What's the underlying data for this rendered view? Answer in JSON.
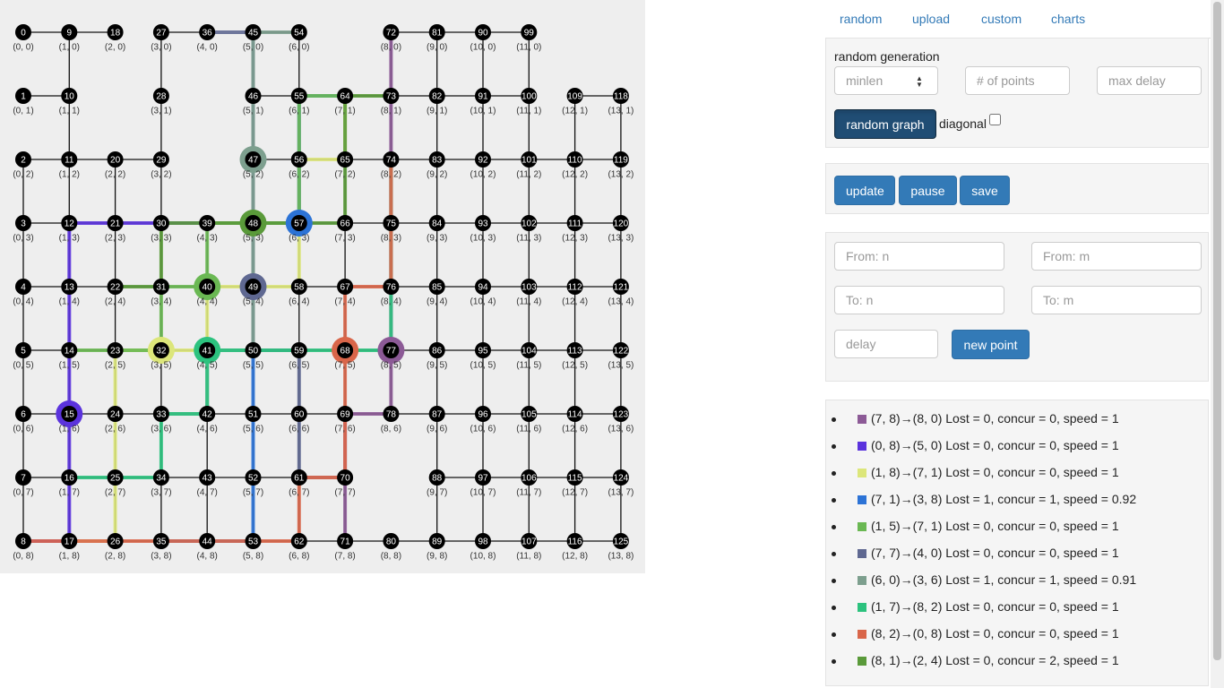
{
  "nav": {
    "random": "random",
    "upload": "upload",
    "custom": "custom",
    "charts": "charts"
  },
  "random_generation": {
    "title": "random generation",
    "minlen_placeholder": "minlen",
    "points_placeholder": "# of points",
    "max_delay_placeholder": "max delay",
    "random_graph_label": "random graph",
    "diagonal_label": "diagonal",
    "diagonal_checked": false
  },
  "controls": {
    "update_label": "update",
    "pause_label": "pause",
    "save_label": "save"
  },
  "new_point": {
    "from_n_placeholder": "From: n",
    "from_m_placeholder": "From: m",
    "to_n_placeholder": "To: n",
    "to_m_placeholder": "To: m",
    "delay_placeholder": "delay",
    "new_point_label": "new point"
  },
  "legend": [
    {
      "color": "#8c5a96",
      "text": "(7, 8)→(8, 0) Lost = 0, concur = 0, speed = 1"
    },
    {
      "color": "#5b33dd",
      "text": "(0, 8)→(5, 0) Lost = 0, concur = 0, speed = 1"
    },
    {
      "color": "#dce67a",
      "text": "(1, 8)→(7, 1) Lost = 0, concur = 0, speed = 1"
    },
    {
      "color": "#2c73d6",
      "text": "(7, 1)→(3, 8) Lost = 1, concur = 1, speed = 0.92"
    },
    {
      "color": "#6ab853",
      "text": "(1, 5)→(7, 1) Lost = 0, concur = 0, speed = 1"
    },
    {
      "color": "#5f6891",
      "text": "(7, 7)→(4, 0) Lost = 0, concur = 0, speed = 1"
    },
    {
      "color": "#7d9f8e",
      "text": "(6, 0)→(3, 6) Lost = 1, concur = 1, speed = 0.91"
    },
    {
      "color": "#2cc27e",
      "text": "(1, 7)→(8, 2) Lost = 0, concur = 0, speed = 1"
    },
    {
      "color": "#d9664a",
      "text": "(8, 2)→(0, 8) Lost = 0, concur = 0, speed = 1"
    },
    {
      "color": "#5a9a3a",
      "text": "(8, 1)→(2, 4) Lost = 0, concur = 2, speed = 1"
    }
  ],
  "graph": {
    "node_ids": [
      [
        0,
        1,
        2,
        3,
        4,
        5,
        6,
        7,
        8
      ],
      [
        9,
        10,
        11,
        12,
        13,
        14,
        15,
        16,
        17
      ],
      [
        18,
        null,
        20,
        21,
        22,
        23,
        24,
        25,
        26
      ],
      [
        27,
        28,
        29,
        30,
        31,
        32,
        33,
        34,
        35
      ],
      [
        36,
        null,
        null,
        39,
        40,
        41,
        42,
        43,
        44
      ],
      [
        45,
        46,
        47,
        48,
        49,
        50,
        51,
        52,
        53
      ],
      [
        54,
        55,
        56,
        57,
        58,
        59,
        60,
        61,
        62
      ],
      [
        null,
        64,
        65,
        66,
        67,
        68,
        69,
        70,
        71
      ],
      [
        72,
        73,
        74,
        75,
        76,
        77,
        78,
        null,
        80
      ],
      [
        81,
        82,
        83,
        84,
        85,
        86,
        87,
        88,
        89
      ],
      [
        90,
        91,
        92,
        93,
        94,
        95,
        96,
        97,
        98
      ],
      [
        99,
        100,
        101,
        102,
        103,
        104,
        105,
        106,
        107
      ],
      [
        null,
        109,
        110,
        111,
        112,
        113,
        114,
        115,
        116
      ],
      [
        null,
        118,
        119,
        120,
        121,
        122,
        123,
        124,
        125
      ]
    ],
    "missing_edges": [
      [
        [
          2,
          0
        ],
        [
          3,
          0
        ]
      ],
      [
        [
          4,
          0
        ],
        [
          5,
          0
        ]
      ],
      [
        [
          6,
          0
        ],
        [
          8,
          0
        ]
      ],
      [
        [
          0,
          0
        ],
        [
          0,
          1
        ]
      ],
      [
        [
          0,
          1
        ],
        [
          0,
          2
        ]
      ],
      [
        [
          2,
          0
        ],
        [
          2,
          1
        ]
      ],
      [
        [
          2,
          1
        ],
        [
          2,
          2
        ]
      ],
      [
        [
          6,
          7
        ],
        [
          7,
          7
        ]
      ],
      [
        [
          7,
          7
        ],
        [
          8,
          7
        ]
      ],
      [
        [
          8,
          7
        ],
        [
          9,
          7
        ]
      ],
      [
        [
          8,
          6
        ],
        [
          8,
          7
        ]
      ],
      [
        [
          8,
          7
        ],
        [
          8,
          8
        ]
      ],
      [
        [
          11,
          1
        ],
        [
          12,
          1
        ]
      ]
    ],
    "paths": [
      {
        "color": "#8c5a96",
        "points": [
          [
            7,
            8
          ],
          [
            7,
            7
          ],
          [
            7,
            6
          ],
          [
            8,
            6
          ],
          [
            8,
            5
          ],
          [
            8,
            4
          ],
          [
            8,
            3
          ],
          [
            8,
            2
          ],
          [
            8,
            1
          ],
          [
            8,
            0
          ]
        ]
      },
      {
        "color": "#5b33dd",
        "points": [
          [
            0,
            8
          ],
          [
            1,
            8
          ],
          [
            1,
            7
          ],
          [
            1,
            6
          ],
          [
            1,
            5
          ],
          [
            1,
            4
          ],
          [
            1,
            3
          ],
          [
            2,
            3
          ],
          [
            3,
            3
          ],
          [
            4,
            3
          ],
          [
            5,
            3
          ],
          [
            5,
            2
          ],
          [
            5,
            1
          ],
          [
            5,
            0
          ]
        ]
      },
      {
        "color": "#dce67a",
        "points": [
          [
            1,
            8
          ],
          [
            2,
            8
          ],
          [
            2,
            7
          ],
          [
            2,
            6
          ],
          [
            2,
            5
          ],
          [
            3,
            5
          ],
          [
            4,
            5
          ],
          [
            4,
            4
          ],
          [
            5,
            4
          ],
          [
            6,
            4
          ],
          [
            6,
            3
          ],
          [
            6,
            2
          ],
          [
            7,
            2
          ],
          [
            7,
            1
          ]
        ]
      },
      {
        "color": "#2c73d6",
        "points": [
          [
            7,
            1
          ],
          [
            6,
            1
          ],
          [
            6,
            2
          ],
          [
            6,
            3
          ],
          [
            5,
            3
          ],
          [
            5,
            4
          ],
          [
            5,
            5
          ],
          [
            5,
            6
          ],
          [
            5,
            7
          ],
          [
            5,
            8
          ],
          [
            4,
            8
          ],
          [
            3,
            8
          ]
        ]
      },
      {
        "color": "#6ab853",
        "points": [
          [
            1,
            5
          ],
          [
            2,
            5
          ],
          [
            3,
            5
          ],
          [
            3,
            4
          ],
          [
            4,
            4
          ],
          [
            4,
            3
          ],
          [
            5,
            3
          ],
          [
            6,
            3
          ],
          [
            6,
            2
          ],
          [
            6,
            1
          ],
          [
            7,
            1
          ]
        ]
      },
      {
        "color": "#5f6891",
        "points": [
          [
            7,
            7
          ],
          [
            6,
            7
          ],
          [
            6,
            6
          ],
          [
            6,
            5
          ],
          [
            5,
            5
          ],
          [
            5,
            4
          ],
          [
            5,
            3
          ],
          [
            5,
            2
          ],
          [
            5,
            1
          ],
          [
            5,
            0
          ],
          [
            4,
            0
          ]
        ]
      },
      {
        "color": "#7d9f8e",
        "points": [
          [
            6,
            0
          ],
          [
            5,
            0
          ],
          [
            5,
            1
          ],
          [
            5,
            2
          ],
          [
            5,
            3
          ],
          [
            5,
            4
          ],
          [
            5,
            5
          ],
          [
            4,
            5
          ],
          [
            4,
            6
          ],
          [
            3,
            6
          ]
        ]
      },
      {
        "color": "#2cc27e",
        "points": [
          [
            1,
            7
          ],
          [
            2,
            7
          ],
          [
            3,
            7
          ],
          [
            3,
            6
          ],
          [
            4,
            6
          ],
          [
            4,
            5
          ],
          [
            5,
            5
          ],
          [
            6,
            5
          ],
          [
            7,
            5
          ],
          [
            8,
            5
          ],
          [
            8,
            4
          ],
          [
            8,
            3
          ],
          [
            8,
            2
          ]
        ]
      },
      {
        "color": "#d9664a",
        "points": [
          [
            8,
            2
          ],
          [
            8,
            3
          ],
          [
            8,
            4
          ],
          [
            7,
            4
          ],
          [
            7,
            5
          ],
          [
            7,
            6
          ],
          [
            7,
            7
          ],
          [
            6,
            7
          ],
          [
            6,
            8
          ],
          [
            5,
            8
          ],
          [
            4,
            8
          ],
          [
            3,
            8
          ],
          [
            2,
            8
          ],
          [
            1,
            8
          ],
          [
            0,
            8
          ]
        ]
      },
      {
        "color": "#5a9a3a",
        "points": [
          [
            8,
            1
          ],
          [
            7,
            1
          ],
          [
            7,
            2
          ],
          [
            7,
            3
          ],
          [
            6,
            3
          ],
          [
            5,
            3
          ],
          [
            4,
            3
          ],
          [
            3,
            3
          ],
          [
            3,
            4
          ],
          [
            2,
            4
          ]
        ]
      }
    ],
    "rings": [
      {
        "at": [
          5,
          2
        ],
        "color": "#7d9f8e"
      },
      {
        "at": [
          5,
          3
        ],
        "color": "#5a9a3a"
      },
      {
        "at": [
          6,
          3
        ],
        "color": "#2c73d6"
      },
      {
        "at": [
          4,
          4
        ],
        "color": "#6ab853"
      },
      {
        "at": [
          5,
          4
        ],
        "color": "#5f6891"
      },
      {
        "at": [
          3,
          5
        ],
        "color": "#dce67a"
      },
      {
        "at": [
          4,
          5
        ],
        "color": "#2cc27e"
      },
      {
        "at": [
          7,
          5
        ],
        "color": "#d9664a"
      },
      {
        "at": [
          8,
          5
        ],
        "color": "#8c5a96"
      },
      {
        "at": [
          1,
          6
        ],
        "color": "#5b33dd"
      }
    ]
  }
}
